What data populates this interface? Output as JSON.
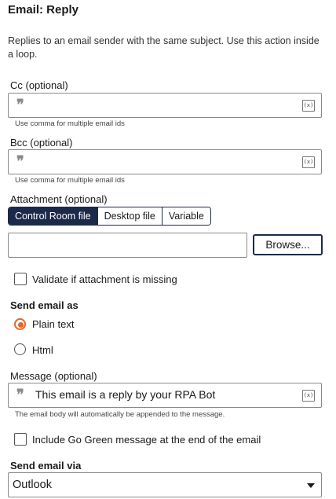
{
  "panel": {
    "title": "Email: Reply",
    "description": "Replies to an email sender with the same subject. Use this action inside a loop."
  },
  "cc": {
    "label": "Cc (optional)",
    "value": "",
    "hint": "Use comma for multiple email ids",
    "var_icon": "(x)"
  },
  "bcc": {
    "label": "Bcc (optional)",
    "value": "",
    "hint": "Use comma for multiple email ids",
    "var_icon": "(x)"
  },
  "attachment": {
    "label": "Attachment (optional)",
    "tabs": [
      "Control Room file",
      "Desktop file",
      "Variable"
    ],
    "selected_tab": "Control Room file",
    "path_value": "",
    "browse_label": "Browse...",
    "validate_label": "Validate if attachment is missing",
    "validate_checked": false
  },
  "send_as": {
    "label": "Send email as",
    "options": [
      "Plain text",
      "Html"
    ],
    "selected": "Plain text"
  },
  "message": {
    "label": "Message (optional)",
    "value": "This email is a reply by your RPA Bot",
    "hint": "The email body will automatically be appended to the message.",
    "var_icon": "(x)",
    "go_green_label": "Include Go Green message at the end of the email",
    "go_green_checked": false
  },
  "send_via": {
    "label": "Send email via",
    "selected": "Outlook"
  },
  "colors": {
    "accent": "#e8632b",
    "navy": "#1b2a4a"
  }
}
